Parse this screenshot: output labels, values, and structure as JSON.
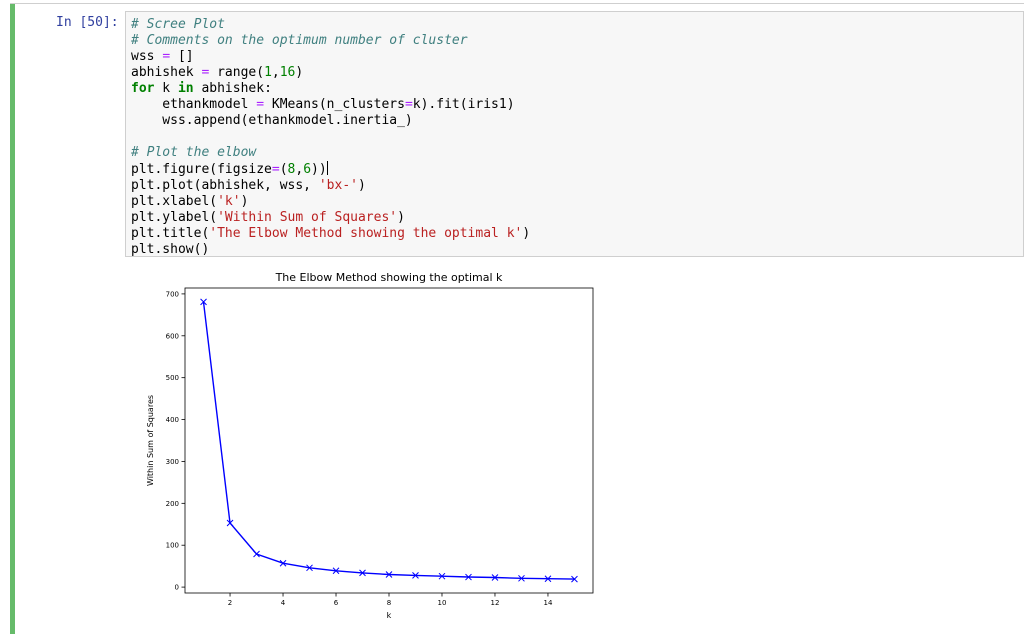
{
  "cell": {
    "prompt": "In [50]:",
    "code": {
      "l1": "# Scree Plot",
      "l2": "# Comments on the optimum number of cluster",
      "l3a": "wss ",
      "l3b": "=",
      "l3c": " []",
      "l4a": "abhishek ",
      "l4b": "=",
      "l4c": " range(",
      "l4d": "1",
      "l4e": ",",
      "l4f": "16",
      "l4g": ")",
      "l5a": "for",
      "l5b": " k ",
      "l5c": "in",
      "l5d": " abhishek:",
      "l6a": "    ethankmodel ",
      "l6b": "=",
      "l6c": " KMeans(n_clusters",
      "l6d": "=",
      "l6e": "k).fit(iris1)",
      "l7": "    wss.append(ethankmodel.inertia_)",
      "l9": "# Plot the elbow",
      "l10a": "plt.figure(figsize",
      "l10b": "=",
      "l10c": "(",
      "l10d": "8",
      "l10e": ",",
      "l10f": "6",
      "l10g": "))",
      "l11a": "plt.plot(abhishek, wss, ",
      "l11b": "'bx-'",
      "l11c": ")",
      "l12a": "plt.xlabel(",
      "l12b": "'k'",
      "l12c": ")",
      "l13a": "plt.ylabel(",
      "l13b": "'Within Sum of Squares'",
      "l13c": ")",
      "l14a": "plt.title(",
      "l14b": "'The Elbow Method showing the optimal k'",
      "l14c": ")",
      "l15": "plt.show()"
    }
  },
  "colors": {
    "cell_bar": "#66bb6a",
    "series": "#0000ff"
  },
  "chart_data": {
    "type": "line",
    "title": "The Elbow Method showing the optimal k",
    "xlabel": "k",
    "ylabel": "Within Sum of Squares",
    "x": [
      1,
      2,
      3,
      4,
      5,
      6,
      7,
      8,
      9,
      10,
      11,
      12,
      13,
      14,
      15
    ],
    "series": [
      {
        "marker": "x",
        "color": "#0000ff",
        "values": [
          681,
          153,
          79,
          57,
          46,
          39,
          34,
          30,
          28,
          26,
          24,
          23,
          21,
          20,
          19
        ]
      }
    ],
    "xticks": [
      2,
      4,
      6,
      8,
      10,
      12,
      14
    ],
    "yticks": [
      0,
      100,
      200,
      300,
      400,
      500,
      600,
      700
    ],
    "xlim": [
      0.3,
      15.7
    ],
    "ylim": [
      -14.1,
      714.1
    ],
    "grid": false
  }
}
